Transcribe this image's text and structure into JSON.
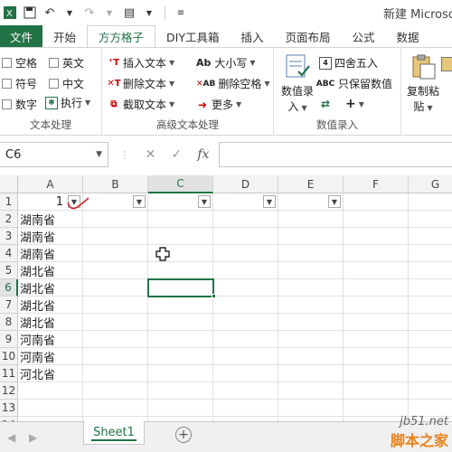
{
  "app": {
    "title": "新建 Microso"
  },
  "tabs": [
    {
      "label": "文件"
    },
    {
      "label": "开始"
    },
    {
      "label": "方方格子"
    },
    {
      "label": "DIY工具箱"
    },
    {
      "label": "插入"
    },
    {
      "label": "页面布局"
    },
    {
      "label": "公式"
    },
    {
      "label": "数据"
    }
  ],
  "ribbon": {
    "text_group": {
      "label": "文本处理",
      "space": "空格",
      "english": "英文",
      "symbol": "符号",
      "chinese": "中文",
      "digit": "数字",
      "execute": "执行"
    },
    "adv_group": {
      "label": "高级文本处理",
      "insert_text": "插入文本",
      "delete_text": "删除文本",
      "extract_text": "截取文本",
      "case": "大小写",
      "delete_space": "删除空格",
      "more": "更多",
      "ab": "Ab",
      "ab2": "AB"
    },
    "num_group": {
      "label": "数值录入",
      "value_entry": "数值录",
      "value_entry2": "入",
      "round": "四舍五入",
      "keep_value": "只保留数值",
      "plus": "+",
      "copy_paste": "复制粘",
      "copy_paste2": "贴"
    }
  },
  "formula_bar": {
    "name_box": "C6",
    "fx": "fx",
    "formula": ""
  },
  "grid": {
    "columns": [
      "A",
      "B",
      "C",
      "D",
      "E",
      "F",
      "G"
    ],
    "rows": [
      "1",
      "2",
      "3",
      "4",
      "5",
      "6",
      "7",
      "8",
      "9",
      "10",
      "11",
      "12",
      "13",
      "14"
    ],
    "a1_value": "1",
    "provinces": [
      "湖南省",
      "湖南省",
      "湖南省",
      "湖北省",
      "湖北省",
      "湖北省",
      "湖北省",
      "河南省",
      "河南省",
      "河北省"
    ]
  },
  "sheets": [
    {
      "label": "Sheet1"
    }
  ],
  "watermark": {
    "line1": "jb51.net",
    "line2": "脚本之家"
  },
  "colors": {
    "accent": "#217346",
    "annotation": "#d9252b"
  }
}
